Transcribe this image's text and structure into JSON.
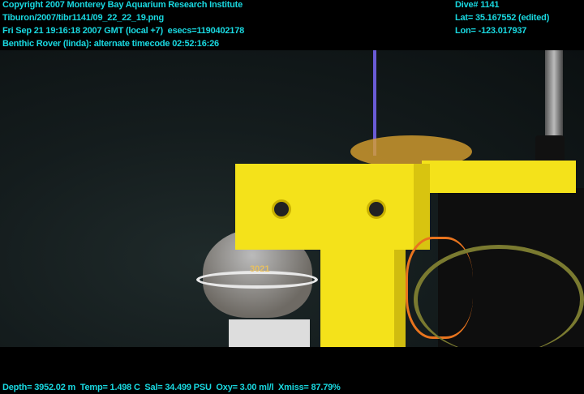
{
  "header_left": {
    "copyright": "Copyright 2007 Monterey Bay Aquarium Research Institute",
    "file_path": "Tiburon/2007/tibr1141/09_22_22_19.png",
    "datetime": "Fri Sep 21 19:16:18 2007 GMT (local +7)  esecs=1190402178",
    "timecode": "Benthic Rover (linda): alternate timecode 02:52:16:26"
  },
  "header_right": {
    "dive": "Dive# 1141",
    "lat": "Lat= 35.167552 (edited)",
    "lon": "Lon= -123.017937"
  },
  "footer": {
    "sensors": "Depth= 3952.02 m  Temp= 1.498 C  Sal= 34.499 PSU  Oxy= 3.00 ml/l  Xmiss= 87.79%"
  },
  "scene": {
    "sphere_label": "3021",
    "colors": {
      "frame": "#f4e21a",
      "text": "#19d8e0",
      "cable": "#e8741e"
    }
  }
}
